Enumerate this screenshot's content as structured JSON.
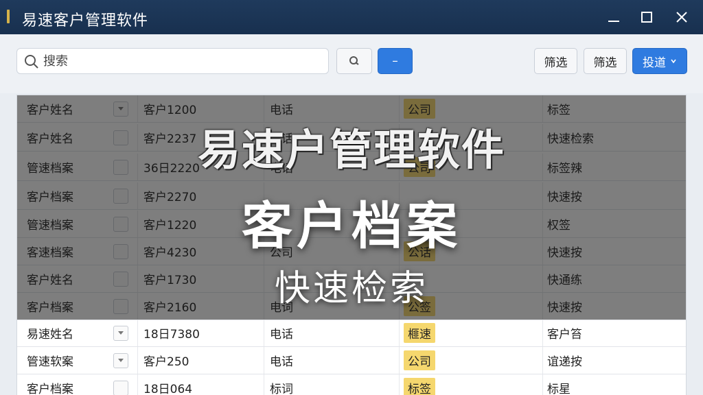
{
  "window": {
    "title": "易速客户管理软件"
  },
  "toolbar": {
    "search_placeholder": "搜索",
    "minus_label": "–",
    "filter1_label": "筛选",
    "filter2_label": "筛选",
    "dropdown_label": "投道"
  },
  "table": {
    "rows": [
      {
        "c1": "客户姓名",
        "c2": "客户1200",
        "c3": "电话",
        "c4": "公司",
        "c5": "标签"
      },
      {
        "c1": "客户姓名",
        "c2": "客户2237",
        "c3": "电话",
        "c4": "",
        "c5": "快速检索"
      },
      {
        "c1": "管速档案",
        "c2": "36日2220",
        "c3": "电话",
        "c4": "公司",
        "c5": "标签辣"
      },
      {
        "c1": "客户档案",
        "c2": "客户2270",
        "c3": "",
        "c4": "",
        "c5": "快速按"
      },
      {
        "c1": "管速档案",
        "c2": "客户1220",
        "c3": "",
        "c4": "",
        "c5": "权签"
      },
      {
        "c1": "客速档案",
        "c2": "客户4230",
        "c3": "公司",
        "c4": "公话",
        "c5": "快速按"
      },
      {
        "c1": "客户姓名",
        "c2": "客户1730",
        "c3": "",
        "c4": "",
        "c5": "快通练"
      },
      {
        "c1": "客户档案",
        "c2": "客户2160",
        "c3": "电词",
        "c4": "公签",
        "c5": "快速按"
      },
      {
        "c1": "易速姓名",
        "c2": "18日7380",
        "c3": "电话",
        "c4": "榧速",
        "c5": "客户笞"
      },
      {
        "c1": "管速软案",
        "c2": "客户250",
        "c3": "电话",
        "c4": "公司",
        "c5": "谊递按"
      },
      {
        "c1": "客户档案",
        "c2": "18日064",
        "c3": "标词",
        "c4": "标签",
        "c5": "标星"
      }
    ]
  },
  "overlay": {
    "headline": "易速户管理软件",
    "title": "客户档案",
    "subtitle": "快速检索"
  },
  "colors": {
    "titlebar": "#1f3a5c",
    "accent_blue": "#2f7be0",
    "tag_yellow": "#f5d76e"
  },
  "icons": {
    "search": "search-icon",
    "minimize": "minimize-icon",
    "maximize": "maximize-icon",
    "close": "close-icon",
    "dropdown": "chevron-down-icon",
    "row_sort": "triangle-down-icon"
  }
}
